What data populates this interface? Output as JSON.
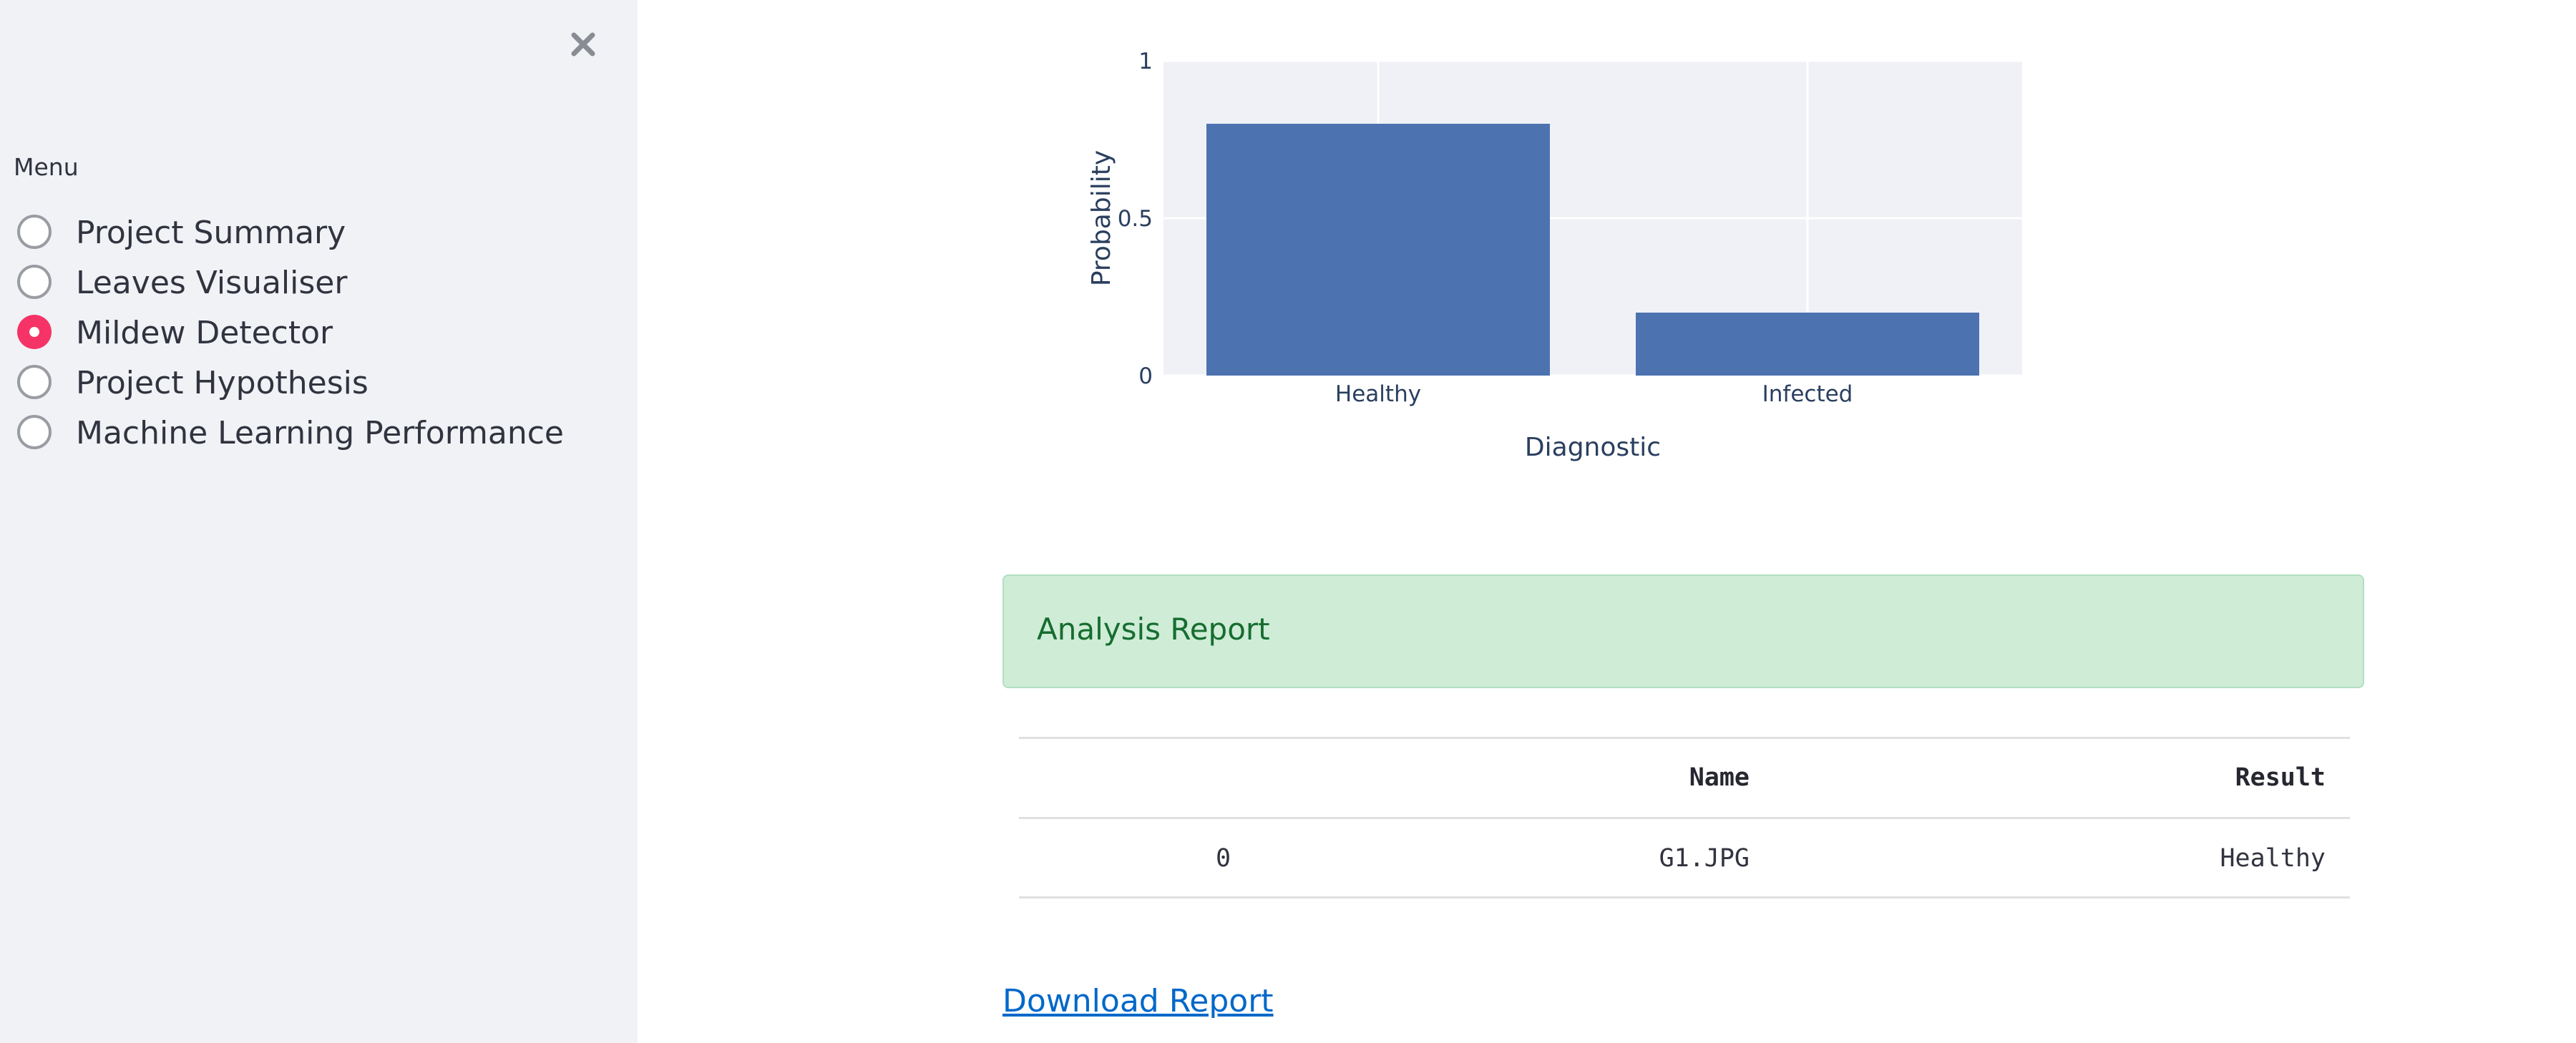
{
  "sidebar": {
    "menu_label": "Menu",
    "items": [
      {
        "label": "Project Summary",
        "selected": false
      },
      {
        "label": "Leaves Visualiser",
        "selected": false
      },
      {
        "label": "Mildew Detector",
        "selected": true
      },
      {
        "label": "Project Hypothesis",
        "selected": false
      },
      {
        "label": "Machine Learning Performance",
        "selected": false
      }
    ],
    "close_icon": "close-icon"
  },
  "chart_data": {
    "type": "bar",
    "categories": [
      "Healthy",
      "Infected"
    ],
    "values": [
      0.8,
      0.2
    ],
    "xlabel": "Diagnostic",
    "ylabel": "Probability",
    "ylim": [
      0,
      1
    ],
    "yticks": [
      "0",
      "0.5",
      "1"
    ],
    "bar_color": "#4c72b0",
    "plot_bg": "#eff1f6",
    "grid": true
  },
  "report": {
    "alert_text": "Analysis Report",
    "alert_bg": "#cfecd7",
    "table": {
      "columns": [
        "",
        "Name",
        "Result"
      ],
      "rows": [
        {
          "index": "0",
          "name": "G1.JPG",
          "result": "Healthy"
        }
      ]
    },
    "download_label": "Download Report"
  },
  "colors": {
    "sidebar_bg": "#f0f2f6",
    "accent": "#f63366",
    "link": "#0068c9"
  }
}
